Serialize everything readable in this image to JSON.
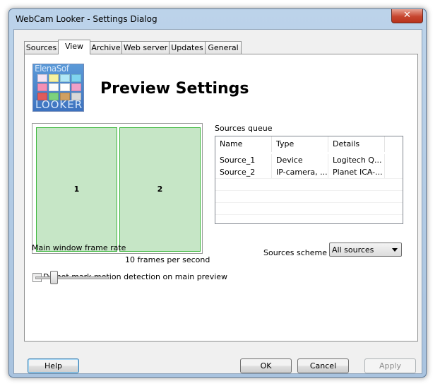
{
  "window": {
    "title": "WebCam Looker - Settings Dialog",
    "close_symbol": "✕"
  },
  "tabs": [
    {
      "label": "Sources"
    },
    {
      "label": "View",
      "active": true
    },
    {
      "label": "Archive"
    },
    {
      "label": "Web server"
    },
    {
      "label": "Updates"
    },
    {
      "label": "General"
    }
  ],
  "logo": {
    "text_top": "ElenaSof",
    "text_bottom": "LOOKER",
    "tile_colors": [
      "#f4e4f4",
      "#f7f3a0",
      "#b0e8f7",
      "#7fd4ef",
      "#f48fb4",
      "#fbfbfb",
      "#ffffff",
      "#f0a0c8",
      "#e05a5a",
      "#7cd27c",
      "#d0a060",
      "#d8d8d8"
    ]
  },
  "heading": "Preview Settings",
  "preview": {
    "panes": [
      "1",
      "2"
    ]
  },
  "queue": {
    "label": "Sources queue",
    "columns": [
      "Name",
      "Type",
      "Details"
    ],
    "rows": [
      [
        "Source_1",
        "Device",
        "Logitech Q..."
      ],
      [
        "Source_2",
        "IP-camera, ...",
        "Planet ICA-..."
      ]
    ]
  },
  "scheme": {
    "label": "Sources scheme",
    "value": "All sources"
  },
  "frame_rate": {
    "label": "Main window frame rate",
    "value_text": "10 frames per second",
    "slider_fraction": 0.25
  },
  "motion_checkbox": {
    "label": "Do not mark motion detection on main preview",
    "checked": false
  },
  "buttons": {
    "help": "Help",
    "ok": "OK",
    "cancel": "Cancel",
    "apply": "Apply"
  }
}
